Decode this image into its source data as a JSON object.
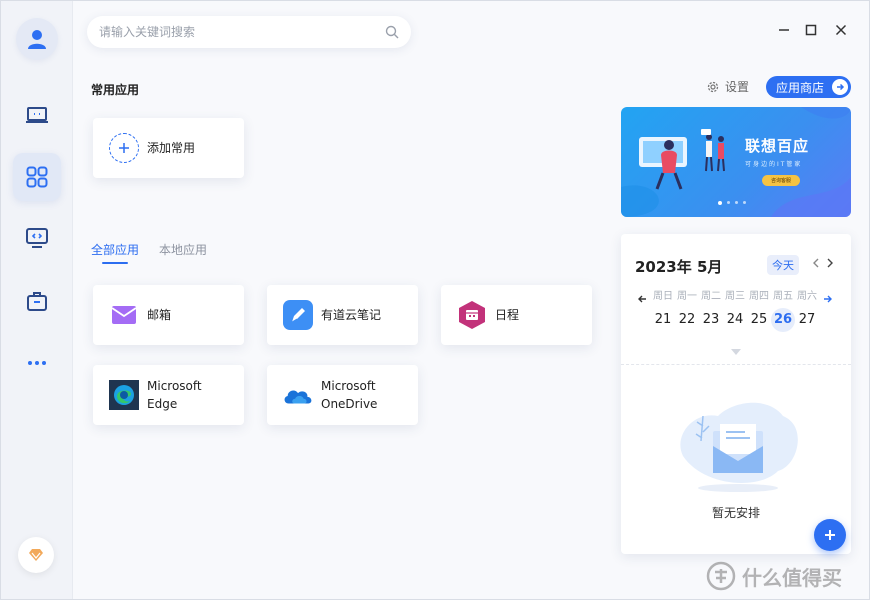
{
  "search": {
    "placeholder": "请输入关键词搜索"
  },
  "common": {
    "title": "常用应用",
    "add_label": "添加常用"
  },
  "header": {
    "settings_label": "设置",
    "store_label": "应用商店"
  },
  "tabs": [
    {
      "label": "全部应用"
    },
    {
      "label": "本地应用"
    }
  ],
  "apps": [
    {
      "name": "邮箱",
      "icon": "mail-icon"
    },
    {
      "name": "有道云笔记",
      "icon": "youdao-note-icon"
    },
    {
      "name": "日程",
      "icon": "calendar-icon"
    },
    {
      "name_line1": "Microsoft",
      "name_line2": "Edge",
      "icon": "edge-icon"
    },
    {
      "name_line1": "Microsoft",
      "name_line2": "OneDrive",
      "icon": "onedrive-icon"
    }
  ],
  "banner": {
    "title": "联想百应",
    "subtitle": "可身边的IT管家",
    "button": "咨询客服"
  },
  "calendar": {
    "title": "2023年 5月",
    "today_label": "今天",
    "weekdays": [
      "周日",
      "周一",
      "周二",
      "周三",
      "周四",
      "周五",
      "周六"
    ],
    "days": [
      "21",
      "22",
      "23",
      "24",
      "25",
      "26",
      "27"
    ],
    "selected_day": "26",
    "empty_text": "暂无安排"
  },
  "watermark": "什么值得买",
  "colors": {
    "accent": "#2d6ff2",
    "sidebar": "#f1f3f8"
  }
}
